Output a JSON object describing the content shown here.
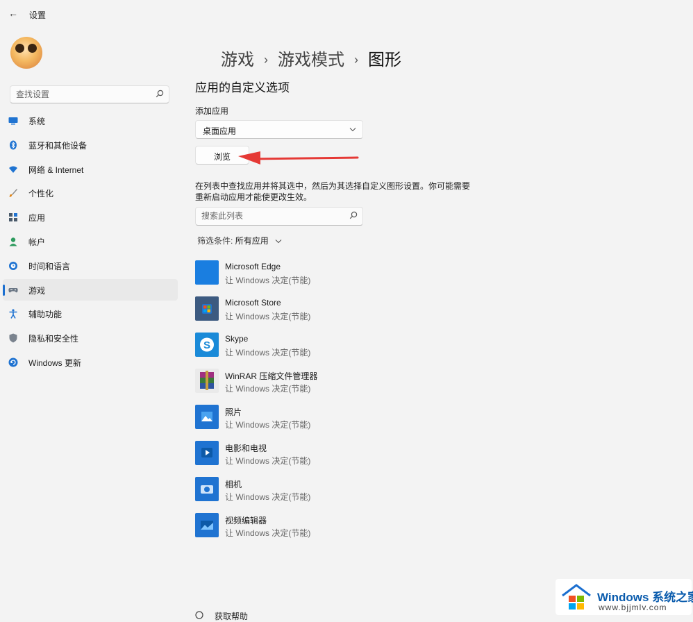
{
  "window": {
    "back_glyph": "←",
    "title": "设置"
  },
  "sidebar": {
    "search_placeholder": "查找设置",
    "items": [
      {
        "label": "系统",
        "icon": "monitor-icon"
      },
      {
        "label": "蓝牙和其他设备",
        "icon": "bluetooth-icon"
      },
      {
        "label": "网络 & Internet",
        "icon": "wifi-icon"
      },
      {
        "label": "个性化",
        "icon": "brush-icon"
      },
      {
        "label": "应用",
        "icon": "apps-icon"
      },
      {
        "label": "帐户",
        "icon": "person-icon"
      },
      {
        "label": "时间和语言",
        "icon": "globe-clock-icon"
      },
      {
        "label": "游戏",
        "icon": "gamepad-icon",
        "active": true
      },
      {
        "label": "辅助功能",
        "icon": "accessibility-icon"
      },
      {
        "label": "隐私和安全性",
        "icon": "shield-icon"
      },
      {
        "label": "Windows 更新",
        "icon": "update-icon"
      }
    ]
  },
  "breadcrumb": {
    "items": [
      "游戏",
      "游戏模式",
      "图形"
    ],
    "separator": "›"
  },
  "main": {
    "section_title": "应用的自定义选项",
    "add_app_label": "添加应用",
    "dropdown_value": "桌面应用",
    "browse_label": "浏览",
    "description": "在列表中查找应用并将其选中，然后为其选择自定义图形设置。你可能需要重新启动应用才能使更改生效。",
    "list_search_placeholder": "搜索此列表",
    "filter_label": "筛选条件:",
    "filter_value": "所有应用"
  },
  "apps": [
    {
      "name": "Microsoft Edge",
      "status": "让 Windows 决定(节能)",
      "color": "#1a7ee0"
    },
    {
      "name": "Microsoft Store",
      "status": "让 Windows 决定(节能)",
      "color": "#2b6fc2"
    },
    {
      "name": "Skype",
      "status": "让 Windows 决定(节能)",
      "color": "#1a8ad8"
    },
    {
      "name": "WinRAR 压缩文件管理器",
      "status": "让 Windows 决定(节能)",
      "color": "#7b2f7a"
    },
    {
      "name": "照片",
      "status": "让 Windows 决定(节能)",
      "color": "#1f73d1"
    },
    {
      "name": "电影和电视",
      "status": "让 Windows 决定(节能)",
      "color": "#1f73d1"
    },
    {
      "name": "相机",
      "status": "让 Windows 决定(节能)",
      "color": "#1f73d1"
    },
    {
      "name": "视频编辑器",
      "status": "让 Windows 决定(节能)",
      "color": "#1f73d1"
    }
  ],
  "footer": {
    "help_label": "获取帮助"
  },
  "watermark": {
    "title_en": "Windows",
    "title_cn": "系统之家",
    "url": "www.bjjmlv.com"
  },
  "colors": {
    "accent": "#1b6fd0",
    "annotation_arrow": "#e53935",
    "background": "#f3f3f3"
  }
}
